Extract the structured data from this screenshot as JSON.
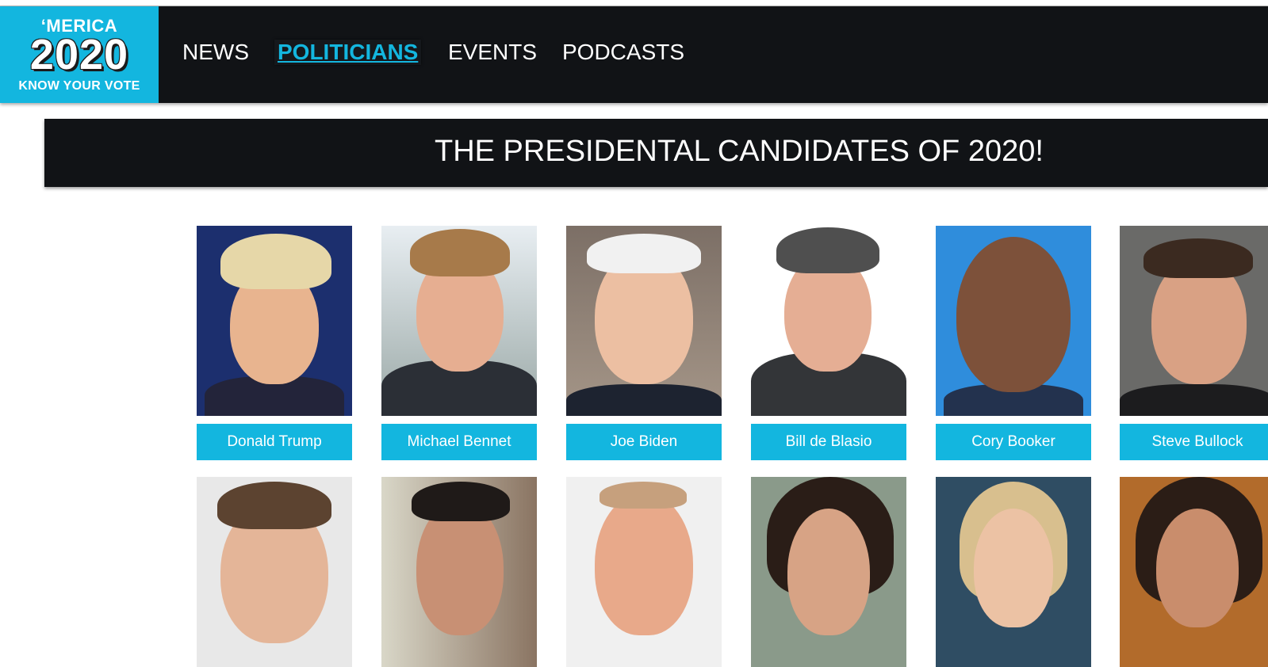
{
  "logo": {
    "line1": "‘MERICA",
    "line2": "2020",
    "line3": "KNOW YOUR VOTE"
  },
  "nav": {
    "items": [
      {
        "label": "NEWS",
        "active": false
      },
      {
        "label": "POLITICIANS",
        "active": true
      },
      {
        "label": "EVENTS",
        "active": false
      },
      {
        "label": "PODCASTS",
        "active": false
      }
    ]
  },
  "banner": {
    "title": "THE PRESIDENTAL CANDIDATES OF 2020!"
  },
  "candidates": {
    "row1": [
      {
        "name": "Donald Trump"
      },
      {
        "name": "Michael Bennet"
      },
      {
        "name": "Joe Biden"
      },
      {
        "name": "Bill de Blasio"
      },
      {
        "name": "Cory Booker"
      },
      {
        "name": "Steve Bullock"
      }
    ]
  },
  "colors": {
    "accent": "#13b6df",
    "dark": "#111316"
  }
}
